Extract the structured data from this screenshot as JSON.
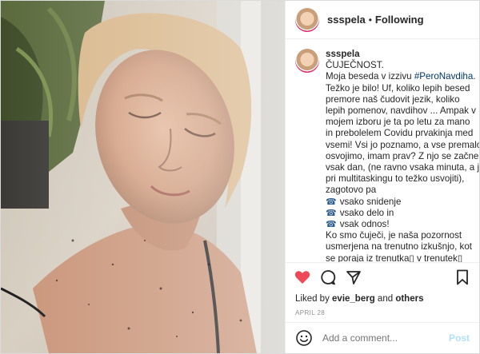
{
  "header": {
    "username": "ssspela",
    "separator": "•",
    "follow_label": "Following"
  },
  "caption": {
    "username": "ssspela",
    "lines": [
      "ČUJEČNOST.",
      "Moja beseda v izzivu ",
      "Težko je bilo! Uf, koliko lepih besed",
      "premore naš čudovit jezik, koliko",
      "lepih pomenov, navdihov ... Ampak v",
      "mojem izboru je ta po letu za mano",
      "in prebolelem Covidu prvakinja med",
      "vsemi! Vsi jo poznamo, a vse premalo",
      "osvojimo, imam prav? Z njo se začne",
      "vsak dan, (ne ravno vsaka minuta, a je",
      "pri multitaskingu to težko usvojiti),",
      "zagotovo pa",
      "vsako snidenje",
      "vsako delo in",
      "vsak odnos!",
      "Ko smo čuječi, je naša pozornost",
      "usmerjena na trenutno izkušnjo, kot",
      "se poraja iz trenutka▯ v trenutek▯"
    ],
    "hashtag": "#PeroNavdiha",
    "hashtag_suffix": "."
  },
  "icons": {
    "phone": "☎",
    "heart": "heart-icon",
    "comment": "comment-icon",
    "share": "share-icon",
    "save": "bookmark-icon",
    "emoji": "emoji-icon"
  },
  "likes": {
    "prefix": "Liked by ",
    "user": "evie_berg",
    "middle": " and ",
    "others": "others"
  },
  "date": "APRIL 28",
  "comment": {
    "placeholder": "Add a comment...",
    "post_label": "Post"
  },
  "colors": {
    "heart": "#ed4956",
    "link": "#00376b",
    "post_disabled": "#b2dffc"
  }
}
